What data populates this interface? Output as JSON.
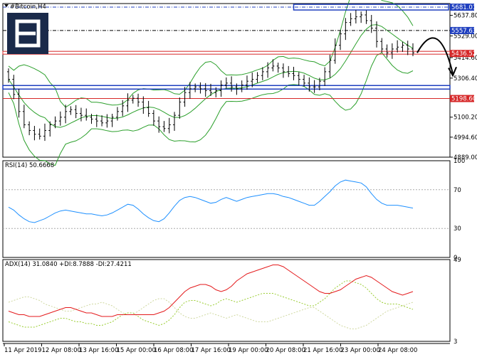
{
  "symbol_title": "#Bitcoin,H4",
  "colors": {
    "candle": "#000000",
    "bollinger": "#2ca02c",
    "rsi": "#1e90ff",
    "adx": "#e41a1c",
    "plus_di": "#9acd32",
    "minus_di": "#cfd8a0",
    "level_blue": "#1f3fbf",
    "level_red": "#d62728"
  },
  "icon": "logo-e-icon",
  "chart_data": [
    {
      "type": "candlestick",
      "title": "#Bitcoin,H4",
      "ylim": [
        4889,
        5700
      ],
      "y_ticks": [
        5637.8,
        5529.0,
        5414.6,
        5306.4,
        5100.2,
        4994.6,
        4889.0
      ],
      "price_tags": [
        {
          "value": "5681.01",
          "style": "blue"
        },
        {
          "value": "5557.63",
          "style": "blue"
        },
        {
          "value": "5436.52",
          "style": "red"
        },
        {
          "value": "5198.60",
          "style": "red"
        }
      ],
      "levels": [
        5681.01,
        5557.63,
        5436.52,
        5256.0,
        5240.0,
        5198.6
      ],
      "closes": [
        5300,
        5220,
        5130,
        5060,
        5030,
        5010,
        5000,
        5030,
        5060,
        5080,
        5100,
        5130,
        5140,
        5120,
        5110,
        5100,
        5090,
        5080,
        5070,
        5080,
        5100,
        5130,
        5160,
        5190,
        5200,
        5180,
        5150,
        5120,
        5080,
        5050,
        5040,
        5060,
        5110,
        5180,
        5230,
        5250,
        5260,
        5250,
        5240,
        5230,
        5240,
        5270,
        5280,
        5260,
        5250,
        5270,
        5290,
        5300,
        5320,
        5340,
        5360,
        5370,
        5360,
        5340,
        5330,
        5320,
        5300,
        5280,
        5260,
        5260,
        5290,
        5340,
        5400,
        5480,
        5540,
        5600,
        5620,
        5630,
        5640,
        5610,
        5570,
        5500,
        5460,
        5440,
        5460,
        5470,
        5480,
        5460,
        5440
      ]
    },
    {
      "type": "line",
      "title": "RSI(14) 50.6668",
      "ylim": [
        0,
        100
      ],
      "y_ticks": [
        100,
        70,
        30,
        0
      ],
      "series": [
        {
          "name": "RSI(14)",
          "values": [
            52,
            49,
            44,
            40,
            37,
            36,
            38,
            40,
            43,
            46,
            48,
            49,
            48,
            47,
            46,
            45,
            45,
            44,
            43,
            44,
            46,
            49,
            52,
            55,
            54,
            50,
            45,
            41,
            38,
            37,
            40,
            46,
            53,
            59,
            62,
            63,
            62,
            60,
            58,
            56,
            57,
            60,
            62,
            60,
            58,
            60,
            62,
            63,
            64,
            65,
            66,
            66,
            65,
            63,
            62,
            60,
            58,
            56,
            54,
            54,
            58,
            63,
            68,
            74,
            78,
            80,
            79,
            78,
            77,
            73,
            66,
            60,
            56,
            54,
            54,
            54,
            53,
            52,
            51
          ]
        }
      ]
    },
    {
      "type": "line",
      "title": "ADX(14) 31.0840 +DI:8.7888 -DI:27.4211",
      "ylim": [
        3,
        49
      ],
      "y_ticks": [
        49,
        3
      ],
      "series": [
        {
          "name": "ADX(14)",
          "values": [
            20,
            19,
            18,
            18,
            17,
            17,
            17,
            18,
            19,
            20,
            21,
            22,
            22,
            21,
            20,
            19,
            19,
            18,
            17,
            17,
            17,
            18,
            18,
            18,
            18,
            18,
            18,
            18,
            18,
            19,
            20,
            22,
            25,
            28,
            31,
            33,
            34,
            35,
            35,
            34,
            32,
            31,
            32,
            34,
            37,
            39,
            41,
            42,
            43,
            44,
            45,
            46,
            46,
            45,
            43,
            41,
            39,
            37,
            35,
            33,
            31,
            30,
            30,
            31,
            32,
            34,
            36,
            38,
            39,
            40,
            39,
            37,
            35,
            33,
            31,
            30,
            29,
            30,
            31
          ]
        },
        {
          "name": "+DI",
          "values": [
            14,
            13,
            12,
            11,
            11,
            11,
            12,
            13,
            14,
            15,
            16,
            16,
            15,
            14,
            14,
            13,
            13,
            12,
            12,
            13,
            14,
            16,
            18,
            19,
            19,
            17,
            15,
            14,
            13,
            12,
            13,
            15,
            18,
            22,
            25,
            26,
            26,
            25,
            24,
            23,
            24,
            26,
            27,
            26,
            25,
            26,
            27,
            28,
            29,
            30,
            30,
            30,
            29,
            28,
            27,
            26,
            25,
            24,
            23,
            23,
            25,
            27,
            30,
            33,
            35,
            37,
            37,
            36,
            35,
            33,
            30,
            27,
            25,
            24,
            24,
            24,
            23,
            22,
            21
          ]
        },
        {
          "name": "-DI",
          "values": [
            25,
            26,
            27,
            28,
            28,
            27,
            26,
            24,
            23,
            22,
            21,
            20,
            20,
            21,
            22,
            23,
            24,
            24,
            25,
            24,
            23,
            21,
            19,
            18,
            18,
            20,
            22,
            24,
            26,
            27,
            27,
            25,
            22,
            19,
            17,
            16,
            16,
            17,
            18,
            19,
            18,
            17,
            16,
            17,
            18,
            17,
            16,
            15,
            14,
            14,
            14,
            15,
            16,
            17,
            18,
            19,
            20,
            21,
            22,
            22,
            20,
            18,
            16,
            14,
            12,
            11,
            10,
            10,
            11,
            12,
            14,
            16,
            18,
            20,
            21,
            22,
            23,
            24,
            25
          ]
        }
      ]
    }
  ],
  "x_axis_labels": [
    "11 Apr 2019",
    "12 Apr 08:00",
    "13 Apr 16:00",
    "15 Apr 00:00",
    "16 Apr 08:00",
    "17 Apr 16:00",
    "19 Apr 00:00",
    "20 Apr 08:00",
    "21 Apr 16:00",
    "23 Apr 00:00",
    "24 Apr 08:00"
  ]
}
